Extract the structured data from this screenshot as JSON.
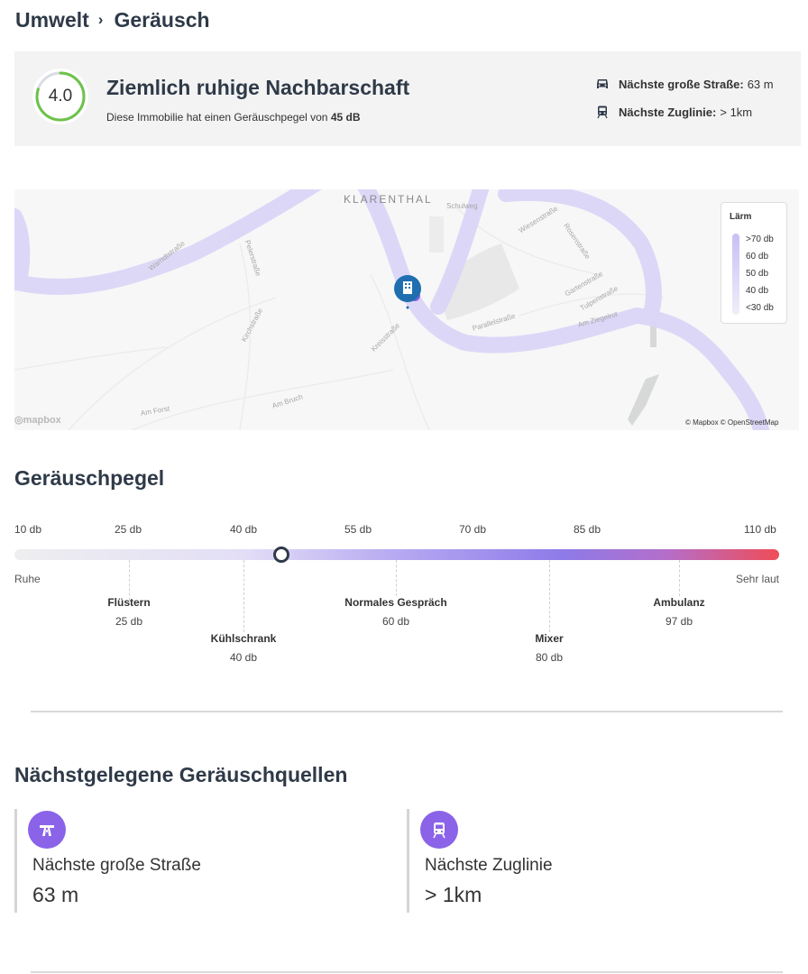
{
  "breadcrumb": {
    "parent": "Umwelt",
    "separator": "›",
    "current": "Geräusch"
  },
  "summary": {
    "score": "4.0",
    "score_fraction": 0.8,
    "title": "Ziemlich ruhige Nachbarschaft",
    "subtitle_prefix": "Diese Immobilie hat einen Geräuschpegel von",
    "subtitle_value": "45 dB",
    "road_label": "Nächste große Straße:",
    "road_value": "63 m",
    "train_label": "Nächste Zuglinie:",
    "train_value": "> 1km",
    "colors": {
      "score_ring": "#6cc24a",
      "score_ring_track": "#d9dde3"
    }
  },
  "map": {
    "district": "KLARENTHAL",
    "streets": [
      "Schulweg",
      "Wiesenstraße",
      "Rosenstraße",
      "Warndtstraße",
      "Pelerstraße",
      "Gartenstraße",
      "Tulpenstraße",
      "Kirchstraße",
      "Kreisstraße",
      "Parallelstraße",
      "Am Ziegelrot",
      "Am Forst",
      "Am Bruch"
    ],
    "legend": {
      "title": "Lärm",
      "items": [
        ">70 db",
        "60 db",
        "50 db",
        "40 db",
        "<30 db"
      ]
    },
    "logo": "mapbox",
    "attribution": "© Mapbox © OpenStreetMap",
    "colors": {
      "noise_band": "#dcd6f7",
      "pin": "#1f6fb0"
    }
  },
  "noise_level": {
    "title": "Geräuschpegel",
    "ticks": [
      "10 db",
      "25 db",
      "40 db",
      "55 db",
      "70 db",
      "85 db",
      "110 db"
    ],
    "current_db": 45,
    "low_label": "Ruhe",
    "high_label": "Sehr laut",
    "references": [
      {
        "name": "Flüstern",
        "value": "25 db"
      },
      {
        "name": "Kühlschrank",
        "value": "40 db"
      },
      {
        "name": "Normales Gespräch",
        "value": "60 db"
      },
      {
        "name": "Mixer",
        "value": "80 db"
      },
      {
        "name": "Ambulanz",
        "value": "97 db"
      }
    ]
  },
  "sources": {
    "title": "Nächstgelegene Geräuschquellen",
    "road": {
      "label": "Nächste große Straße",
      "value": "63 m",
      "icon": "road-icon"
    },
    "train": {
      "label": "Nächste Zuglinie",
      "value": "> 1km",
      "icon": "train-icon"
    },
    "colors": {
      "icon_bg": "#8a63e8"
    }
  }
}
